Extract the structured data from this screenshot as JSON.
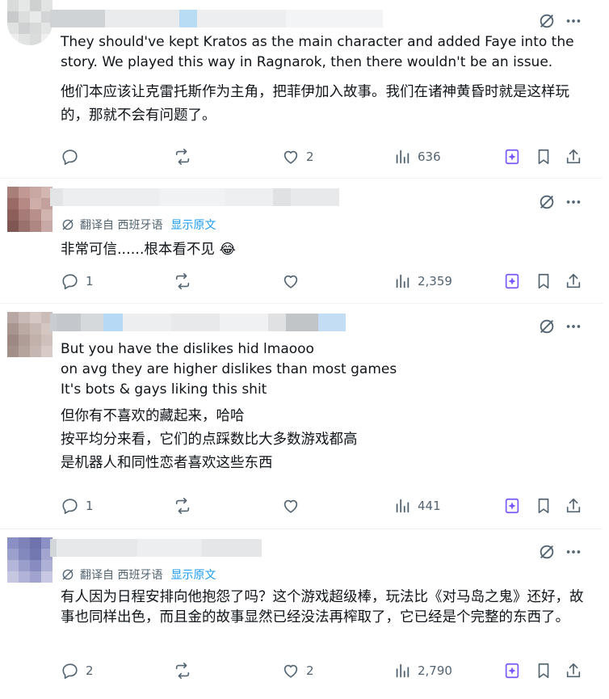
{
  "posts": [
    {
      "text": "They should've kept Kratos as the main character and added Faye into the story. We played this way in Ragnarok, then there wouldn't be an issue.",
      "translation": "他们本应该让克雷托斯作为主角，把菲伊加入故事。我们在诸神黄昏时就是这样玩的，那就不会有问题了。",
      "counts": {
        "replies": "",
        "reposts": "",
        "likes": "2",
        "views": "636"
      }
    },
    {
      "translate_prefix": "翻译自 西班牙语",
      "translate_link": "显示原文",
      "text": "非常可信......根本看不见 😂",
      "counts": {
        "replies": "1",
        "reposts": "",
        "likes": "",
        "views": "2,359"
      }
    },
    {
      "text": "But you have the dislikes hid lmaooo\non avg they are higher dislikes than most games\nIt's bots & gays liking this shit",
      "translation": "但你有不喜欢的藏起来，哈哈\n按平均分来看，它们的点踩数比大多数游戏都高\n是机器人和同性恋者喜欢这些东西",
      "counts": {
        "replies": "1",
        "reposts": "",
        "likes": "",
        "views": "441"
      }
    },
    {
      "translate_prefix": "翻译自 西班牙语",
      "translate_link": "显示原文",
      "text": "有人因为日程安排向他抱怨了吗？这个游戏超级棒，玩法比《对马岛之鬼》还好，故事也同样出色，而且金的故事显然已经没法再榨取了，它已经是个完整的东西了。",
      "counts": {
        "replies": "2",
        "reposts": "",
        "likes": "2",
        "views": "2,790"
      }
    }
  ],
  "icons": {
    "reply": "reply-icon",
    "repost": "repost-icon",
    "like": "heart-icon",
    "views": "views-chart-icon",
    "grok": "grok-icon",
    "more": "more-dots-icon",
    "bookmark_alt": "grok-bookmark-icon",
    "bookmark": "bookmark-icon",
    "share": "share-icon",
    "translate": "translate-grok-icon"
  },
  "colors": {
    "text": "#0f1419",
    "muted": "#536471",
    "link": "#1d9bf0",
    "grok_accent": "#7856ff",
    "divider": "#eff3f4"
  }
}
